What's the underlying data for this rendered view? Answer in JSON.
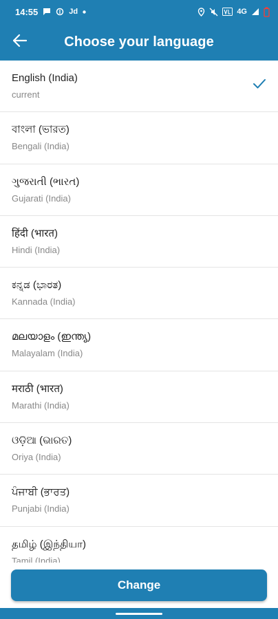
{
  "status_bar": {
    "time": "14:55",
    "carrier_text": "Jd",
    "network_text": "4G"
  },
  "app_bar": {
    "title": "Choose your language"
  },
  "languages": [
    {
      "native": "English (India)",
      "sub": "current",
      "selected": true
    },
    {
      "native": "বাংলা (ভারত)",
      "sub": "Bengali (India)",
      "selected": false
    },
    {
      "native": "ગુજરાતી (ભારત)",
      "sub": "Gujarati (India)",
      "selected": false
    },
    {
      "native": "हिंदी (भारत)",
      "sub": "Hindi (India)",
      "selected": false
    },
    {
      "native": "ಕನ್ನಡ (ಭಾರತ)",
      "sub": "Kannada (India)",
      "selected": false
    },
    {
      "native": "മലയാളം (ഇന്ത്യ)",
      "sub": "Malayalam (India)",
      "selected": false
    },
    {
      "native": "मराठी (भारत)",
      "sub": "Marathi (India)",
      "selected": false
    },
    {
      "native": "ଓଡ଼ିଆ (ଭାରତ)",
      "sub": "Oriya (India)",
      "selected": false
    },
    {
      "native": "ਪੰਜਾਬੀ (ਭਾਰਤ)",
      "sub": "Punjabi (India)",
      "selected": false
    },
    {
      "native": "தமிழ் (இந்தியா)",
      "sub": "Tamil (India)",
      "selected": false
    }
  ],
  "change_button": {
    "label": "Change"
  },
  "colors": {
    "primary": "#1f7fb3",
    "check": "#1f7fb3"
  }
}
